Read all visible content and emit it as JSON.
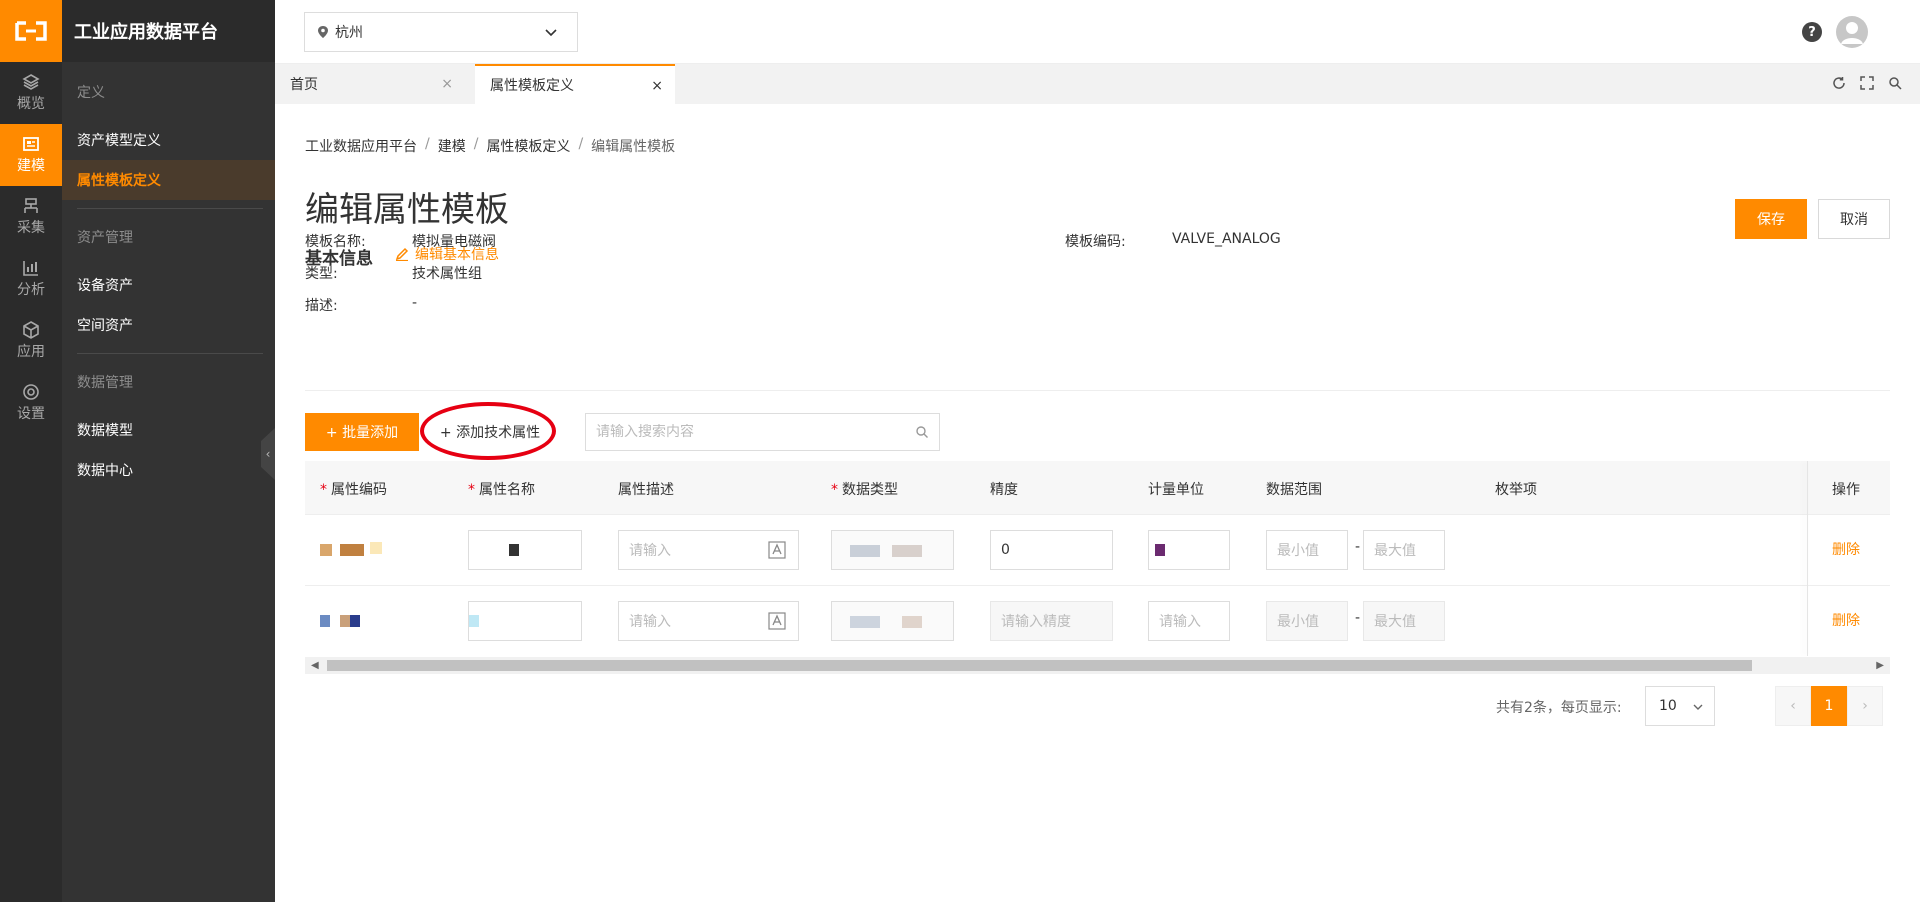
{
  "app": {
    "title": "工业应用数据平台",
    "accent": "#ff8a00"
  },
  "rail": [
    {
      "label": "概览",
      "icon": "layers-icon"
    },
    {
      "label": "建模",
      "icon": "model-icon",
      "active": true
    },
    {
      "label": "采集",
      "icon": "collect-icon"
    },
    {
      "label": "分析",
      "icon": "chart-icon"
    },
    {
      "label": "应用",
      "icon": "cube-icon"
    },
    {
      "label": "设置",
      "icon": "gear-icon"
    }
  ],
  "sidebar": {
    "group1": "定义",
    "item_asset_model": "资产模型定义",
    "item_attr_template": "属性模板定义",
    "group2": "资产管理",
    "item_device_asset": "设备资产",
    "item_space_asset": "空间资产",
    "group3": "数据管理",
    "item_data_model": "数据模型",
    "item_data_center": "数据中心"
  },
  "header": {
    "city": "杭州",
    "help": "?"
  },
  "tabs": [
    {
      "label": "首页"
    },
    {
      "label": "属性模板定义",
      "active": true
    }
  ],
  "breadcrumb": [
    "工业数据应用平台",
    "建模",
    "属性模板定义",
    "编辑属性模板"
  ],
  "page": {
    "title": "编辑属性模板",
    "save": "保存",
    "cancel": "取消",
    "basic_info": "基本信息",
    "edit_basic": "编辑基本信息"
  },
  "info": {
    "name_label": "模板名称:",
    "name_value": "模拟量电磁阀",
    "code_label": "模板编码:",
    "code_value": "VALVE_ANALOG",
    "type_label": "类型:",
    "type_value": "技术属性组",
    "desc_label": "描述:",
    "desc_value": "-"
  },
  "toolbar": {
    "batch_add": "+ 批量添加",
    "add_tech": "+ 添加技术属性",
    "search_placeholder": "请输入搜索内容"
  },
  "table": {
    "headers": {
      "code": "属性编码",
      "name": "属性名称",
      "desc": "属性描述",
      "dtype": "数据类型",
      "precision": "精度",
      "unit": "计量单位",
      "range": "数据范围",
      "enum": "枚举项",
      "op": "操作"
    },
    "rows": [
      {
        "desc_placeholder": "请输入",
        "precision": "0",
        "min_placeholder": "最小值",
        "max_placeholder": "最大值",
        "range_sep": "-",
        "delete": "删除"
      },
      {
        "desc_placeholder": "请输入",
        "precision_placeholder": "请输入精度",
        "unit_placeholder": "请输入",
        "min_placeholder": "最小值",
        "max_placeholder": "最大值",
        "range_sep": "-",
        "delete": "删除"
      }
    ]
  },
  "pagination": {
    "total_text": "共有2条，每页显示:",
    "page_size": "10",
    "current_page": "1"
  }
}
